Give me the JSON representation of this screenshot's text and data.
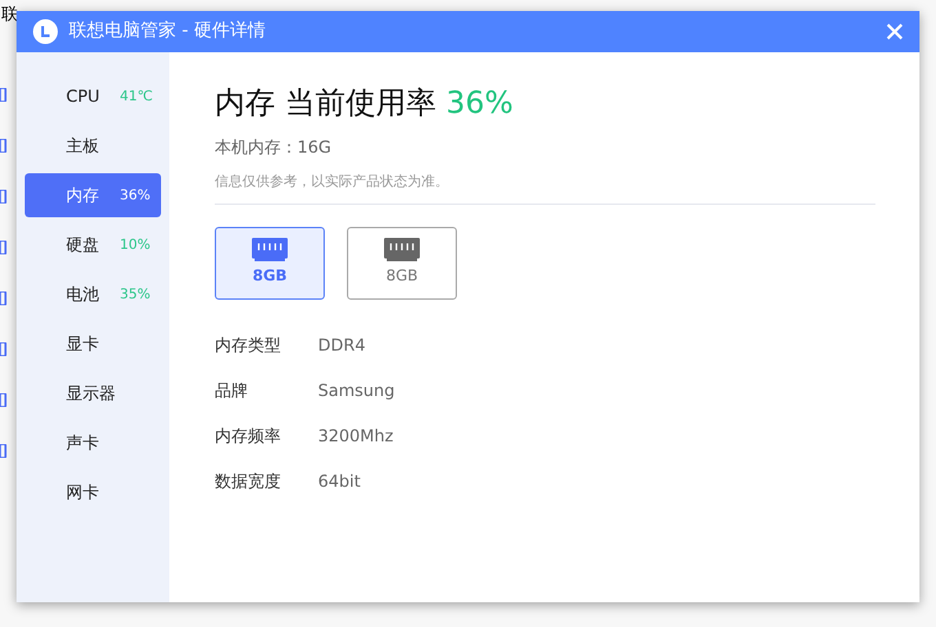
{
  "background_app": {
    "title": "联"
  },
  "window": {
    "title": "联想电脑管家 - 硬件详情"
  },
  "sidebar": {
    "items": [
      {
        "label": "CPU",
        "reading": "41℃",
        "selected": false
      },
      {
        "label": "主板",
        "selected": false
      },
      {
        "label": "内存",
        "reading": "36%",
        "selected": true
      },
      {
        "label": "硬盘",
        "reading": "10%",
        "selected": false
      },
      {
        "label": "电池",
        "reading": "35%",
        "selected": false
      },
      {
        "label": "显卡",
        "selected": false
      },
      {
        "label": "显示器",
        "selected": false
      },
      {
        "label": "声卡",
        "selected": false
      },
      {
        "label": "网卡",
        "selected": false
      }
    ]
  },
  "heading": {
    "title": "内存 当前使用率",
    "value": "36%"
  },
  "total": "本机内存：16G",
  "note": "信息仅供参考，以实际产品状态为准。",
  "modules": [
    {
      "label": "8GB",
      "selected": true
    },
    {
      "label": "8GB",
      "selected": false
    }
  ],
  "details": [
    {
      "label": "内存类型",
      "value": "DDR4"
    },
    {
      "label": "品牌",
      "value": "Samsung"
    },
    {
      "label": "内存频率",
      "value": "3200Mhz"
    },
    {
      "label": "数据宽度",
      "value": "64bit"
    }
  ]
}
